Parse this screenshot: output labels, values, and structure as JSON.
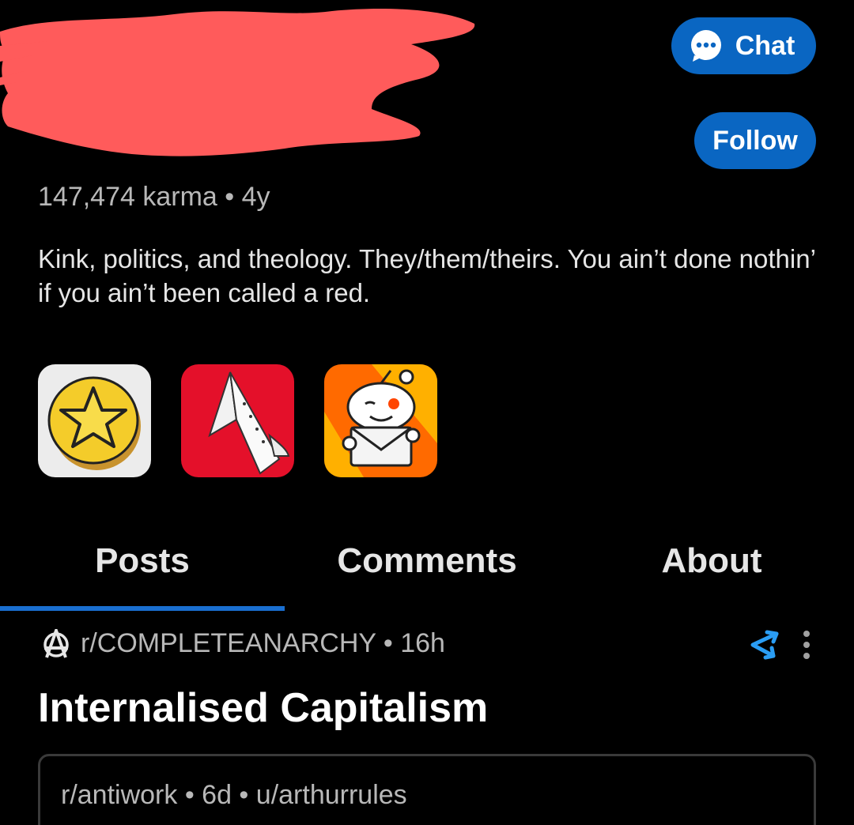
{
  "header": {
    "chat_label": "Chat",
    "follow_label": "Follow"
  },
  "profile": {
    "meta": "147,474 karma • 4y",
    "bio": "Kink, politics, and theology. They/them/theirs. You ain’t done nothin’ if you ain’t been called a red."
  },
  "trophies": [
    "coin-star-icon",
    "paper-plane-icon",
    "snoo-mail-icon"
  ],
  "tabs": [
    {
      "label": "Posts",
      "active": true
    },
    {
      "label": "Comments",
      "active": false
    },
    {
      "label": "About",
      "active": false
    }
  ],
  "post": {
    "meta": "r/COMPLETEANARCHY • 16h",
    "title": "Internalised Capitalism",
    "crosspost_meta": "r/antiwork • 6d • u/arthurrules"
  },
  "colors": {
    "accent": "#0a66c2",
    "redaction": "#ff5b5b",
    "background": "#000000"
  }
}
